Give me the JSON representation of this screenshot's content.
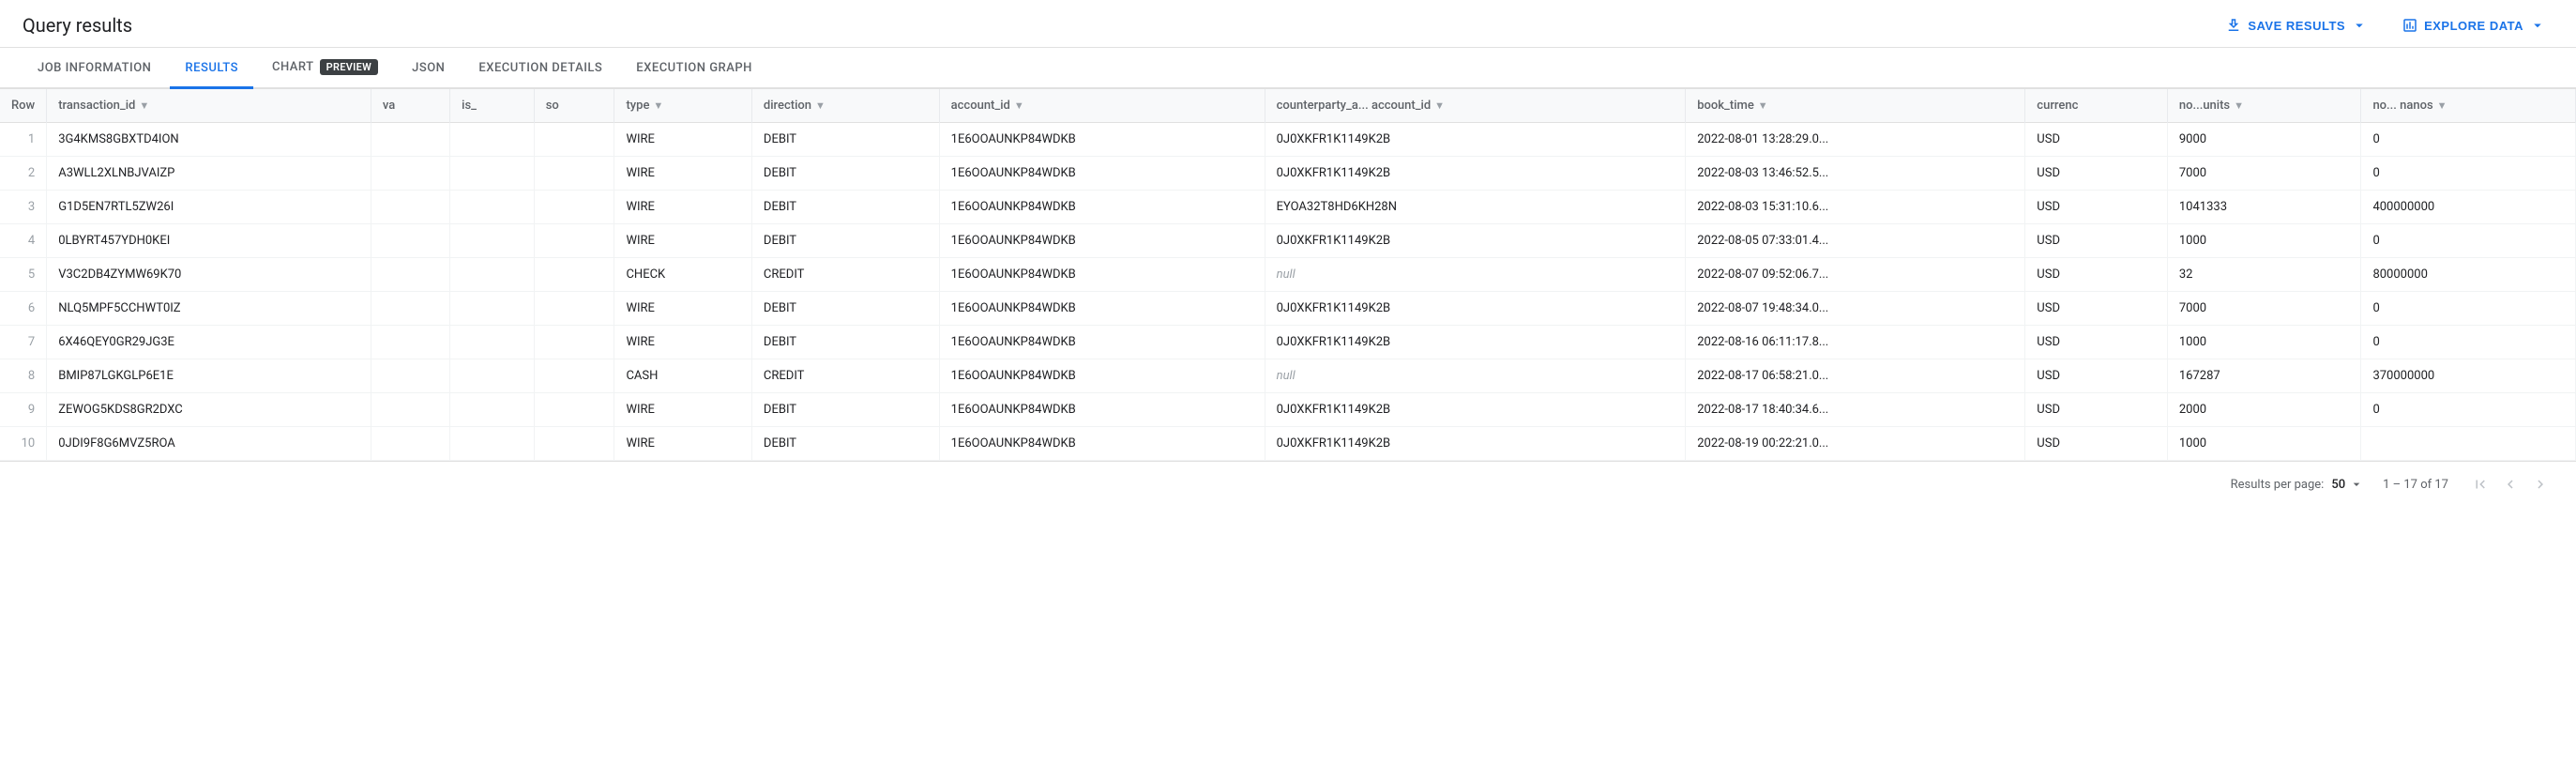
{
  "page": {
    "title": "Query results",
    "save_results_label": "SAVE RESULTS",
    "explore_data_label": "EXPLORE DATA"
  },
  "tabs": [
    {
      "id": "job-information",
      "label": "JOB INFORMATION",
      "active": false
    },
    {
      "id": "results",
      "label": "RESULTS",
      "active": true
    },
    {
      "id": "chart",
      "label": "CHART",
      "active": false,
      "badge": "PREVIEW"
    },
    {
      "id": "json",
      "label": "JSON",
      "active": false
    },
    {
      "id": "execution-details",
      "label": "EXECUTION DETAILS",
      "active": false
    },
    {
      "id": "execution-graph",
      "label": "EXECUTION GRAPH",
      "active": false
    }
  ],
  "table": {
    "columns": [
      {
        "id": "row",
        "label": "Row",
        "sortable": false
      },
      {
        "id": "transaction_id",
        "label": "transaction_id",
        "sortable": true
      },
      {
        "id": "va",
        "label": "va",
        "sortable": false
      },
      {
        "id": "is_",
        "label": "is_",
        "sortable": false
      },
      {
        "id": "so",
        "label": "so",
        "sortable": false
      },
      {
        "id": "type",
        "label": "type",
        "sortable": true
      },
      {
        "id": "direction",
        "label": "direction",
        "sortable": true
      },
      {
        "id": "account_id",
        "label": "account_id",
        "sortable": true
      },
      {
        "id": "counterparty_a_account_id",
        "label": "counterparty_a... account_id",
        "sortable": true
      },
      {
        "id": "book_time",
        "label": "book_time",
        "sortable": true
      },
      {
        "id": "currency",
        "label": "currenc",
        "sortable": false
      },
      {
        "id": "no_units",
        "label": "no...units",
        "sortable": true
      },
      {
        "id": "no_nanos",
        "label": "no... nanos",
        "sortable": true
      }
    ],
    "rows": [
      {
        "row": 1,
        "transaction_id": "3G4KMS8GBXTD4ION",
        "va": "",
        "is_": "",
        "so": "",
        "type": "WIRE",
        "direction": "DEBIT",
        "account_id": "1E6OOAUNKP84WDKB",
        "counterparty": "0J0XKFR1K1149K2B",
        "book_time": "2022-08-01 13:28:29.0...",
        "currency": "USD",
        "no_units": "9000",
        "no_nanos": "0"
      },
      {
        "row": 2,
        "transaction_id": "A3WLL2XLNBJVAIZP",
        "va": "",
        "is_": "",
        "so": "",
        "type": "WIRE",
        "direction": "DEBIT",
        "account_id": "1E6OOAUNKP84WDKB",
        "counterparty": "0J0XKFR1K1149K2B",
        "book_time": "2022-08-03 13:46:52.5...",
        "currency": "USD",
        "no_units": "7000",
        "no_nanos": "0"
      },
      {
        "row": 3,
        "transaction_id": "G1D5EN7RTL5ZW26I",
        "va": "",
        "is_": "",
        "so": "",
        "type": "WIRE",
        "direction": "DEBIT",
        "account_id": "1E6OOAUNKP84WDKB",
        "counterparty": "EYOA32T8HD6KH28N",
        "book_time": "2022-08-03 15:31:10.6...",
        "currency": "USD",
        "no_units": "1041333",
        "no_nanos": "400000000"
      },
      {
        "row": 4,
        "transaction_id": "0LBYRT457YDH0KEI",
        "va": "",
        "is_": "",
        "so": "",
        "type": "WIRE",
        "direction": "DEBIT",
        "account_id": "1E6OOAUNKP84WDKB",
        "counterparty": "0J0XKFR1K1149K2B",
        "book_time": "2022-08-05 07:33:01.4...",
        "currency": "USD",
        "no_units": "1000",
        "no_nanos": "0"
      },
      {
        "row": 5,
        "transaction_id": "V3C2DB4ZYMW69K70",
        "va": "",
        "is_": "",
        "so": "",
        "type": "CHECK",
        "direction": "CREDIT",
        "account_id": "1E6OOAUNKP84WDKB",
        "counterparty": null,
        "book_time": "2022-08-07 09:52:06.7...",
        "currency": "USD",
        "no_units": "32",
        "no_nanos": "80000000"
      },
      {
        "row": 6,
        "transaction_id": "NLQ5MPF5CCHWT0IZ",
        "va": "",
        "is_": "",
        "so": "",
        "type": "WIRE",
        "direction": "DEBIT",
        "account_id": "1E6OOAUNKP84WDKB",
        "counterparty": "0J0XKFR1K1149K2B",
        "book_time": "2022-08-07 19:48:34.0...",
        "currency": "USD",
        "no_units": "7000",
        "no_nanos": "0"
      },
      {
        "row": 7,
        "transaction_id": "6X46QEY0GR29JG3E",
        "va": "",
        "is_": "",
        "so": "",
        "type": "WIRE",
        "direction": "DEBIT",
        "account_id": "1E6OOAUNKP84WDKB",
        "counterparty": "0J0XKFR1K1149K2B",
        "book_time": "2022-08-16 06:11:17.8...",
        "currency": "USD",
        "no_units": "1000",
        "no_nanos": "0"
      },
      {
        "row": 8,
        "transaction_id": "BMIP87LGKGLP6E1E",
        "va": "",
        "is_": "",
        "so": "",
        "type": "CASH",
        "direction": "CREDIT",
        "account_id": "1E6OOAUNKP84WDKB",
        "counterparty": null,
        "book_time": "2022-08-17 06:58:21.0...",
        "currency": "USD",
        "no_units": "167287",
        "no_nanos": "370000000"
      },
      {
        "row": 9,
        "transaction_id": "ZEWOG5KDS8GR2DXC",
        "va": "",
        "is_": "",
        "so": "",
        "type": "WIRE",
        "direction": "DEBIT",
        "account_id": "1E6OOAUNKP84WDKB",
        "counterparty": "0J0XKFR1K1149K2B",
        "book_time": "2022-08-17 18:40:34.6...",
        "currency": "USD",
        "no_units": "2000",
        "no_nanos": "0"
      },
      {
        "row": 10,
        "transaction_id": "0JDI9F8G6MVZ5ROA",
        "va": "",
        "is_": "",
        "so": "",
        "type": "WIRE",
        "direction": "DEBIT",
        "account_id": "1E6OOAUNKP84WDKB",
        "counterparty": "0J0XKFR1K1149K2B",
        "book_time": "2022-08-19 00:22:21.0...",
        "currency": "USD",
        "no_units": "1000",
        "no_nanos": ""
      }
    ]
  },
  "footer": {
    "per_page_label": "Results per page:",
    "per_page_value": "50",
    "pagination_range": "1 – 17 of 17"
  }
}
